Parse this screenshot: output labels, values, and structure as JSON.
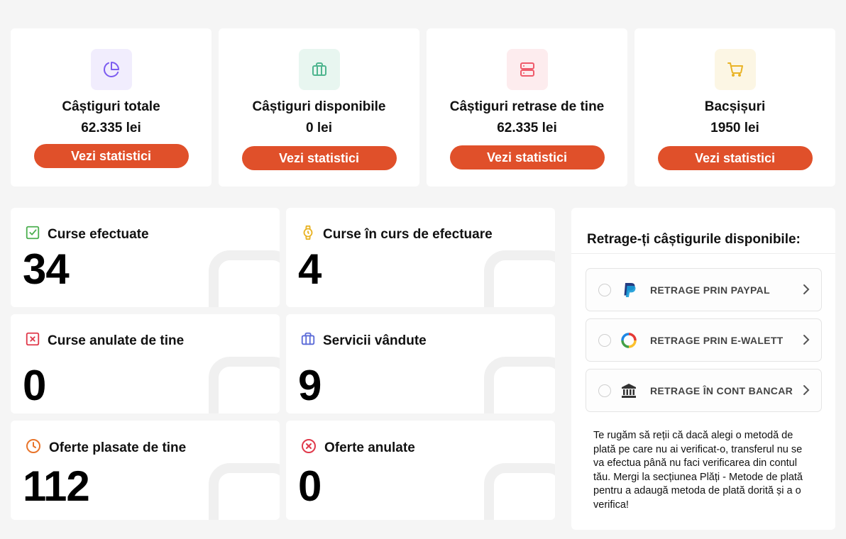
{
  "earnings": [
    {
      "title": "Câștiguri totale",
      "value": "62.335 lei",
      "button": "Vezi statistici",
      "icon": "pie-chart-icon",
      "color": "#7c5cf0",
      "bg": "#f1edfd"
    },
    {
      "title": "Câștiguri disponibile",
      "value": "0 lei",
      "button": "Vezi statistici",
      "icon": "briefcase-icon",
      "color": "#4fb58f",
      "bg": "#e8f6f0"
    },
    {
      "title": "Câștiguri retrase de tine",
      "value": "62.335 lei",
      "button": "Vezi statistici",
      "icon": "server-icon",
      "color": "#ef5b6b",
      "bg": "#fdecee"
    },
    {
      "title": "Bacșișuri",
      "value": "1950 lei",
      "button": "Vezi statistici",
      "icon": "cart-icon",
      "color": "#e9b325",
      "bg": "#fcf6e4"
    }
  ],
  "stats": [
    {
      "label": "Curse efectuate",
      "value": "34",
      "icon": "check-square-icon",
      "color": "#4caf50"
    },
    {
      "label": "Curse în curs de efectuare",
      "value": "4",
      "icon": "watch-icon",
      "color": "#e9b325"
    },
    {
      "label": "Curse anulate de tine",
      "value": "0",
      "icon": "x-square-icon",
      "color": "#e0394b"
    },
    {
      "label": "Servicii vândute",
      "value": "9",
      "icon": "briefcase-icon",
      "color": "#5b6bd8"
    },
    {
      "label": "Oferte plasate de tine",
      "value": "112",
      "icon": "clock-icon",
      "color": "#e8742a"
    },
    {
      "label": "Oferte anulate",
      "value": "0",
      "icon": "x-circle-icon",
      "color": "#e0394b"
    }
  ],
  "withdraw": {
    "title": "Retrage-ți câștigurile disponibile:",
    "options": [
      {
        "label": "RETRAGE PRIN PAYPAL",
        "icon": "paypal-icon"
      },
      {
        "label": "RETRAGE PRIN E-WALETT",
        "icon": "ewallet-icon"
      },
      {
        "label": "RETRAGE ÎN CONT BANCAR",
        "icon": "bank-icon"
      }
    ],
    "note": "Te rugăm să reții că dacă alegi o metodă de plată pe care nu ai verificat-o, transferul nu se va efectua până nu faci verificarea din contul tău. Mergi la secțiunea Plăți - Metode de plată pentru a adaugă metoda de plată dorită și a o verifica!"
  }
}
